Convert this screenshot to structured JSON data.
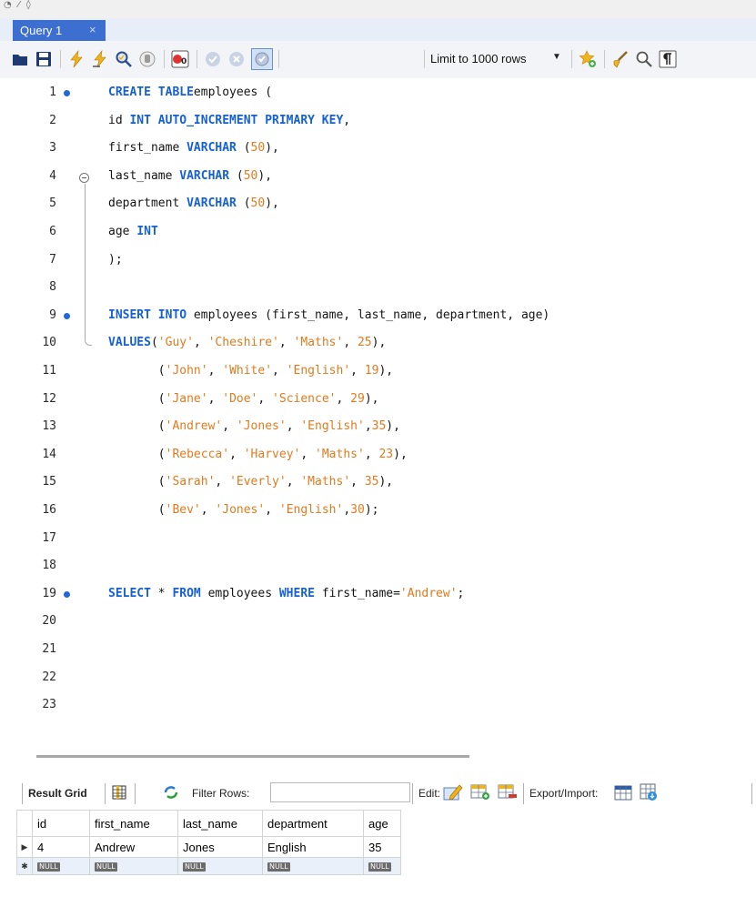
{
  "tab": {
    "title": "Query 1",
    "close": "×"
  },
  "toolbar": {
    "limit_label": "Limit to 1000 rows",
    "icons": [
      "open-folder-icon",
      "save-icon",
      "execute-icon",
      "execute-current-icon",
      "explain-icon",
      "stop-icon",
      "toggle-error-icon",
      "commit-icon",
      "rollback-icon",
      "autocommit-icon",
      "limit-dropdown",
      "add-snippet-icon",
      "beautify-icon",
      "find-icon",
      "invisible-chars-icon"
    ]
  },
  "editor": {
    "lines": [
      {
        "n": "1",
        "dot": true,
        "tokens": [
          [
            "kw",
            "CREATE TABLE"
          ],
          [
            "",
            "employees ("
          ]
        ]
      },
      {
        "n": "2",
        "tokens": [
          [
            "",
            "id "
          ],
          [
            "kw",
            "INT AUTO_INCREMENT PRIMARY KEY"
          ],
          [
            "",
            ","
          ]
        ]
      },
      {
        "n": "3",
        "tokens": [
          [
            "",
            "first_name "
          ],
          [
            "kw",
            "VARCHAR"
          ],
          [
            "",
            " ("
          ],
          [
            "num",
            "50"
          ],
          [
            "",
            "),"
          ]
        ]
      },
      {
        "n": "4",
        "tokens": [
          [
            "",
            "last_name "
          ],
          [
            "kw",
            "VARCHAR"
          ],
          [
            "",
            " ("
          ],
          [
            "num",
            "50"
          ],
          [
            "",
            "),"
          ]
        ]
      },
      {
        "n": "5",
        "tokens": [
          [
            "",
            "department "
          ],
          [
            "kw",
            "VARCHAR"
          ],
          [
            "",
            " ("
          ],
          [
            "num",
            "50"
          ],
          [
            "",
            "),"
          ]
        ]
      },
      {
        "n": "6",
        "tokens": [
          [
            "",
            "age "
          ],
          [
            "kw",
            "INT"
          ]
        ]
      },
      {
        "n": "7",
        "tokens": [
          [
            "",
            ");"
          ]
        ]
      },
      {
        "n": "8",
        "tokens": []
      },
      {
        "n": "9",
        "dot": true,
        "tokens": [
          [
            "kw",
            "INSERT INTO"
          ],
          [
            "",
            " employees (first_name, last_name, department, age)"
          ]
        ]
      },
      {
        "n": "10",
        "tokens": [
          [
            "kw",
            "VALUES"
          ],
          [
            "",
            "("
          ],
          [
            "str",
            "'Guy'"
          ],
          [
            "",
            ", "
          ],
          [
            "str",
            "'Cheshire'"
          ],
          [
            "",
            ", "
          ],
          [
            "str",
            "'Maths'"
          ],
          [
            "",
            ", "
          ],
          [
            "num",
            "25"
          ],
          [
            "",
            "),"
          ]
        ]
      },
      {
        "n": "11",
        "tokens": [
          [
            "",
            "       ("
          ],
          [
            "str",
            "'John'"
          ],
          [
            "",
            ", "
          ],
          [
            "str",
            "'White'"
          ],
          [
            "",
            ", "
          ],
          [
            "str",
            "'English'"
          ],
          [
            "",
            ", "
          ],
          [
            "num",
            "19"
          ],
          [
            "",
            "),"
          ]
        ]
      },
      {
        "n": "12",
        "tokens": [
          [
            "",
            "       ("
          ],
          [
            "str",
            "'Jane'"
          ],
          [
            "",
            ", "
          ],
          [
            "str",
            "'Doe'"
          ],
          [
            "",
            ", "
          ],
          [
            "str",
            "'Science'"
          ],
          [
            "",
            ", "
          ],
          [
            "num",
            "29"
          ],
          [
            "",
            "),"
          ]
        ]
      },
      {
        "n": "13",
        "tokens": [
          [
            "",
            "       ("
          ],
          [
            "str",
            "'Andrew'"
          ],
          [
            "",
            ", "
          ],
          [
            "str",
            "'Jones'"
          ],
          [
            "",
            ", "
          ],
          [
            "str",
            "'English'"
          ],
          [
            "",
            ","
          ],
          [
            "num",
            "35"
          ],
          [
            "",
            "),"
          ]
        ]
      },
      {
        "n": "14",
        "tokens": [
          [
            "",
            "       ("
          ],
          [
            "str",
            "'Rebecca'"
          ],
          [
            "",
            ", "
          ],
          [
            "str",
            "'Harvey'"
          ],
          [
            "",
            ", "
          ],
          [
            "str",
            "'Maths'"
          ],
          [
            "",
            ", "
          ],
          [
            "num",
            "23"
          ],
          [
            "",
            "),"
          ]
        ]
      },
      {
        "n": "15",
        "tokens": [
          [
            "",
            "       ("
          ],
          [
            "str",
            "'Sarah'"
          ],
          [
            "",
            ", "
          ],
          [
            "str",
            "'Everly'"
          ],
          [
            "",
            ", "
          ],
          [
            "str",
            "'Maths'"
          ],
          [
            "",
            ", "
          ],
          [
            "num",
            "35"
          ],
          [
            "",
            "),"
          ]
        ]
      },
      {
        "n": "16",
        "tokens": [
          [
            "",
            "       ("
          ],
          [
            "str",
            "'Bev'"
          ],
          [
            "",
            ", "
          ],
          [
            "str",
            "'Jones'"
          ],
          [
            "",
            ", "
          ],
          [
            "str",
            "'English'"
          ],
          [
            "",
            ","
          ],
          [
            "num",
            "30"
          ],
          [
            "",
            ");"
          ]
        ]
      },
      {
        "n": "17",
        "tokens": []
      },
      {
        "n": "18",
        "tokens": []
      },
      {
        "n": "19",
        "dot": true,
        "tokens": [
          [
            "kw",
            "SELECT"
          ],
          [
            "",
            " * "
          ],
          [
            "kw",
            "FROM"
          ],
          [
            "",
            " employees "
          ],
          [
            "kw",
            "WHERE"
          ],
          [
            "",
            " first_name="
          ],
          [
            "str",
            "'Andrew'"
          ],
          [
            "",
            ";"
          ]
        ]
      },
      {
        "n": "20",
        "tokens": []
      },
      {
        "n": "21",
        "tokens": []
      },
      {
        "n": "22",
        "tokens": []
      },
      {
        "n": "23",
        "tokens": []
      }
    ]
  },
  "results": {
    "result_grid_label": "Result Grid",
    "filter_label": "Filter Rows:",
    "filter_value": "",
    "edit_label": "Edit:",
    "export_label": "Export/Import:",
    "columns": [
      "id",
      "first_name",
      "last_name",
      "department",
      "age"
    ],
    "rows": [
      [
        "4",
        "Andrew",
        "Jones",
        "English",
        "35"
      ]
    ],
    "null_text": "NULL"
  },
  "colors": {
    "tab": "#3d6fd0",
    "keyword": "#1560d5",
    "literal": "#e27a1d",
    "breakpoint": "#2466d6"
  }
}
